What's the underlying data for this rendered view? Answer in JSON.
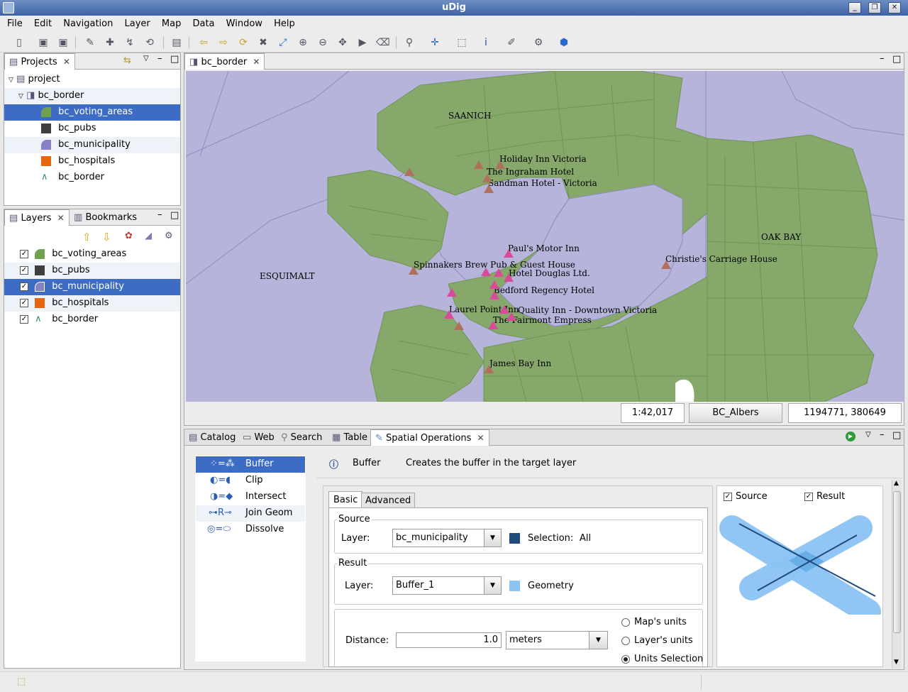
{
  "window": {
    "title": "uDig"
  },
  "menu": [
    "File",
    "Edit",
    "Navigation",
    "Layer",
    "Map",
    "Data",
    "Window",
    "Help"
  ],
  "projects_panel": {
    "tab_label": "Projects",
    "tree": {
      "project": "project",
      "map": "bc_border",
      "layers": [
        "bc_voting_areas",
        "bc_pubs",
        "bc_municipality",
        "bc_hospitals",
        "bc_border"
      ]
    }
  },
  "layers_panel": {
    "tab_label": "Layers",
    "bookmarks_label": "Bookmarks",
    "layers": [
      "bc_voting_areas",
      "bc_pubs",
      "bc_municipality",
      "bc_hospitals",
      "bc_border"
    ],
    "selected": "bc_municipality"
  },
  "map_editor": {
    "tab_label": "bc_border",
    "labels": {
      "saanich": "SAANICH",
      "oak_bay": "OAK BAY",
      "esquimalt": "ESQUIMALT",
      "holiday_inn": "Holiday Inn Victoria",
      "ingraham": "The Ingraham Hotel",
      "sandman": "Sandman Hotel - Victoria",
      "pauls": "Paul's Motor Inn",
      "spinnakers": "Spinnakers Brew Pub & Guest House",
      "douglas": "Hotel Douglas Ltd.",
      "christies": "Christie's Carriage House",
      "bedford": "Bedford Regency Hotel",
      "laurel": "Laurel Point Inn",
      "quality": "Quality Inn - Downtown Victoria",
      "fairmont": "The Fairmont Empress",
      "james_bay": "James Bay Inn"
    },
    "scale": "1:42,017",
    "crs": "BC_Albers",
    "coords": "1194771, 380649"
  },
  "bottom_tabs": [
    "Catalog",
    "Web",
    "Search",
    "Table",
    "Spatial Operations"
  ],
  "spatial_ops": {
    "operations": [
      "Buffer",
      "Clip",
      "Intersect",
      "Join Geom",
      "Dissolve"
    ],
    "selected": "Buffer",
    "info_title": "Buffer",
    "info_desc": "Creates the buffer in the target layer",
    "tabs": [
      "Basic",
      "Advanced"
    ],
    "source": {
      "group": "Source",
      "layer_label": "Layer:",
      "layer_value": "bc_municipality",
      "selection_label": "Selection:",
      "selection_value": "All",
      "color": "#1e4a7e"
    },
    "result": {
      "group": "Result",
      "layer_label": "Layer:",
      "layer_value": "Buffer_1",
      "geometry_label": "Geometry",
      "color": "#8cc4f4"
    },
    "distance": {
      "label": "Distance:",
      "value": "1.0",
      "unit": "meters",
      "radio_options": [
        "Map's units",
        "Layer's units",
        "Units Selection"
      ],
      "radio_selected": "Units Selection"
    },
    "preview": {
      "source_label": "Source",
      "result_label": "Result"
    }
  }
}
